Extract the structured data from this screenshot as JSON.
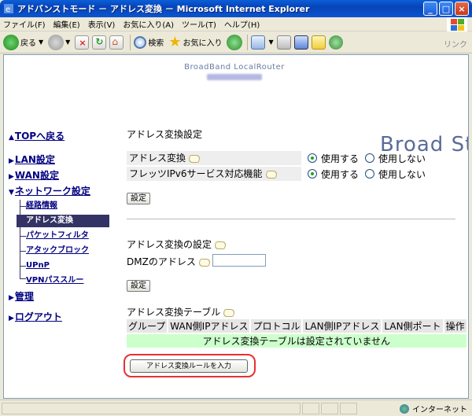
{
  "window": {
    "title": "アドバンストモード － アドレス変換 － Microsoft Internet Explorer"
  },
  "menu": [
    "ファイル(F)",
    "編集(E)",
    "表示(V)",
    "お気に入り(A)",
    "ツール(T)",
    "ヘルプ(H)"
  ],
  "toolbar": {
    "back": "戻る",
    "search": "検索",
    "favorites": "お気に入り",
    "links": "リンク"
  },
  "brand": {
    "subtitle": "BroadBand LocalRouter",
    "title": "Broad Station"
  },
  "sidebar": {
    "top": "TOPへ戻る",
    "lan": "LAN設定",
    "wan": "WAN設定",
    "network": "ネットワーク設定",
    "sub_items": [
      "経路情報",
      "アドレス変換",
      "パケットフィルタ",
      "アタックブロック",
      "UPnP",
      "VPNパススルー"
    ],
    "active_sub": "アドレス変換",
    "admin": "管理",
    "logout": "ログアウト"
  },
  "settings": {
    "title": "アドレス変換設定",
    "rows": [
      {
        "label": "アドレス変換",
        "options": [
          "使用する",
          "使用しない"
        ],
        "selected": "使用する"
      },
      {
        "label": "フレッツIPv6サービス対応機能",
        "options": [
          "使用する",
          "使用しない"
        ],
        "selected": "使用する"
      }
    ],
    "submit": "設定"
  },
  "dmz": {
    "title": "アドレス変換の設定",
    "label": "DMZのアドレス",
    "value": "",
    "submit": "設定"
  },
  "nat_table": {
    "title": "アドレス変換テーブル",
    "columns": [
      "グループ",
      "WAN側IPアドレス",
      "プロトコル",
      "LAN側IPアドレス",
      "LAN側ポート",
      "操作"
    ],
    "empty_message": "アドレス変換テーブルは設定されていません",
    "add_button": "アドレス変換ルールを入力"
  },
  "status": {
    "zone": "インターネット"
  },
  "colors": {
    "accent": "#333366",
    "link": "#000080",
    "table_empty": "#ccffcc",
    "highlight_border": "#e83030"
  }
}
